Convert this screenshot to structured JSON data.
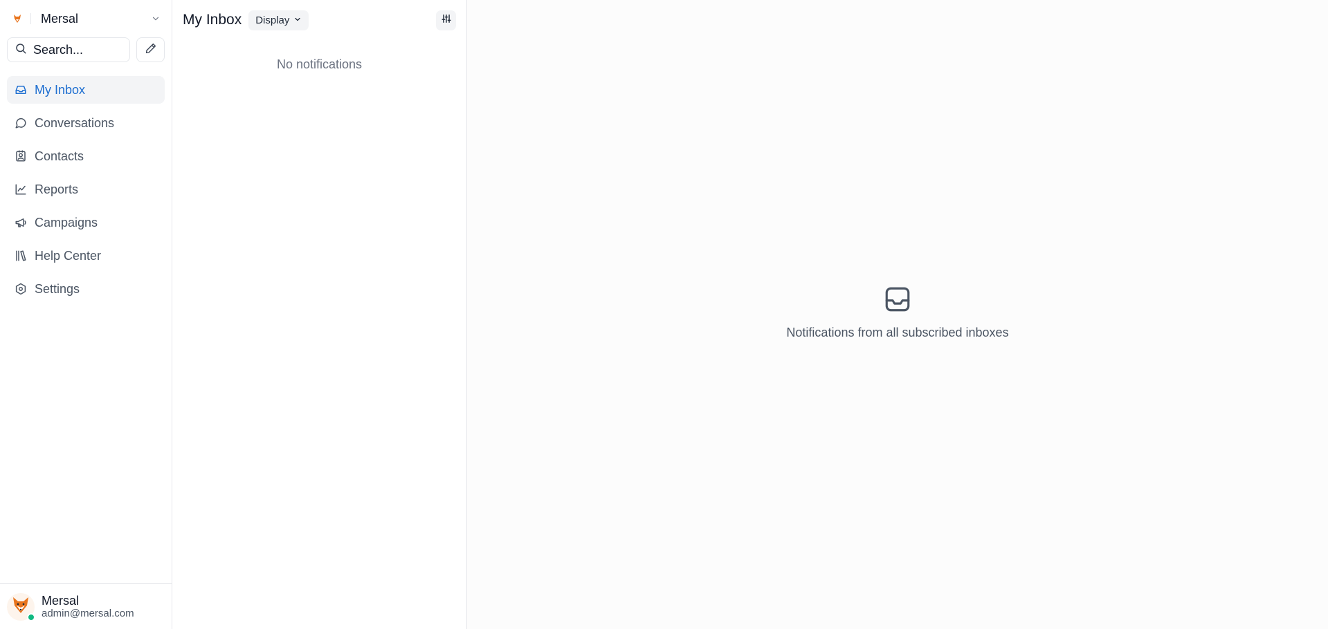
{
  "sidebar": {
    "account_name": "Mersal",
    "search": {
      "placeholder": "Search..."
    },
    "items": [
      {
        "label": "My Inbox",
        "icon": "inbox-icon",
        "active": true
      },
      {
        "label": "Conversations",
        "icon": "chat-bubble-icon"
      },
      {
        "label": "Contacts",
        "icon": "contact-card-icon"
      },
      {
        "label": "Reports",
        "icon": "line-chart-icon"
      },
      {
        "label": "Campaigns",
        "icon": "megaphone-icon"
      },
      {
        "label": "Help Center",
        "icon": "library-icon"
      },
      {
        "label": "Settings",
        "icon": "settings-hexagon-icon"
      }
    ],
    "profile": {
      "name": "Mersal",
      "email": "admin@mersal.com",
      "status": "online"
    }
  },
  "inbox_panel": {
    "title": "My Inbox",
    "display_label": "Display",
    "empty_text": "No notifications"
  },
  "main": {
    "empty_text": "Notifications from all subscribed inboxes",
    "icon": "inbox-tray-icon"
  },
  "colors": {
    "accent": "#1f6fd1",
    "status_online": "#10b981",
    "brand_orange": "#e8741c"
  }
}
